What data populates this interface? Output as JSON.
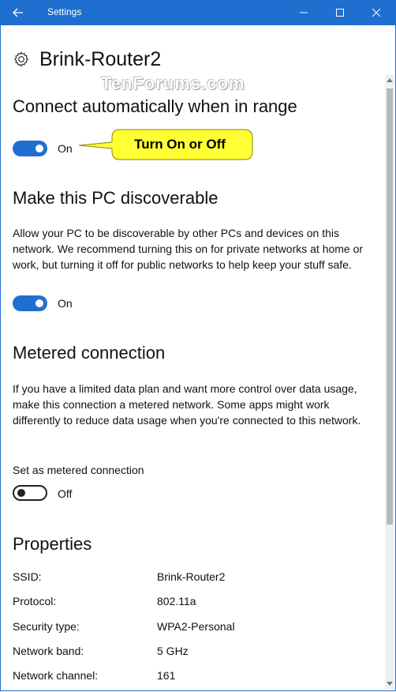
{
  "window": {
    "title": "Settings",
    "accent": "#1f6fd1"
  },
  "header": {
    "title": "Brink-Router2",
    "icon": "gear-icon"
  },
  "watermark": "TenForums.com",
  "callout": {
    "text": "Turn On or Off",
    "color": "#ffff33"
  },
  "connect_auto": {
    "heading": "Connect automatically when in range",
    "toggle_state": "On"
  },
  "discoverable": {
    "heading": "Make this PC discoverable",
    "description": "Allow your PC to be discoverable by other PCs and devices on this network. We recommend turning this on for private networks at home or work, but turning it off for public networks to help keep your stuff safe.",
    "toggle_state": "On"
  },
  "metered": {
    "heading": "Metered connection",
    "description": "If you have a limited data plan and want more control over data usage, make this connection a metered network. Some apps might work differently to reduce data usage when you're connected to this network.",
    "label": "Set as metered connection",
    "toggle_state": "Off"
  },
  "properties": {
    "heading": "Properties",
    "rows": [
      {
        "key": "SSID:",
        "value": "Brink-Router2"
      },
      {
        "key": "Protocol:",
        "value": "802.11a"
      },
      {
        "key": "Security type:",
        "value": "WPA2-Personal"
      },
      {
        "key": "Network band:",
        "value": "5 GHz"
      },
      {
        "key": "Network channel:",
        "value": "161"
      }
    ]
  }
}
